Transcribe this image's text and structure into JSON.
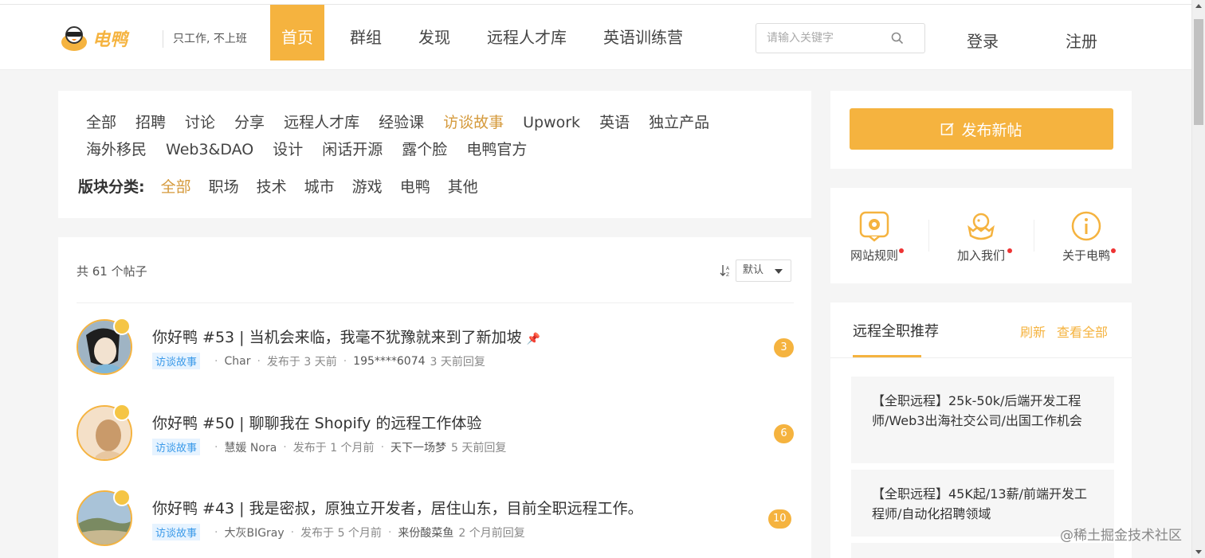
{
  "header": {
    "logo_text": "电鸭",
    "slogan": "只工作, 不上班",
    "nav": [
      "首页",
      "群组",
      "发现",
      "远程人才库",
      "英语训练营"
    ],
    "active_nav": "首页",
    "search_placeholder": "请输入关键字",
    "login": "登录",
    "register": "注册"
  },
  "categories": {
    "tags_row1": [
      "全部",
      "招聘",
      "讨论",
      "分享",
      "远程人才库",
      "经验课",
      "访谈故事",
      "Upwork",
      "英语",
      "独立产品",
      "海外移民"
    ],
    "tags_row2": [
      "Web3&DAO",
      "设计",
      "闲话开源",
      "露个脸",
      "电鸭官方"
    ],
    "selected_tag": "访谈故事",
    "section_label": "版块分类:",
    "sections": [
      "全部",
      "职场",
      "技术",
      "城市",
      "游戏",
      "电鸭",
      "其他"
    ],
    "selected_section": "全部"
  },
  "list": {
    "total": "共 61 个帖子",
    "sort_value": "默认",
    "posts": [
      {
        "title": "你好鸭 #53 | 当机会来临，我毫不犹豫就来到了新加坡",
        "tag": "访谈故事",
        "author": "Char",
        "published": "发布于 3 天前",
        "replier": "195****6074",
        "replied": "3 天前回复",
        "comments": "3"
      },
      {
        "title": "你好鸭 #50 | 聊聊我在 Shopify 的远程工作体验",
        "tag": "访谈故事",
        "author": "慧媛 Nora",
        "published": "发布于 1 个月前",
        "replier": "天下一场梦",
        "replied": "5 天前回复",
        "comments": "6"
      },
      {
        "title": "你好鸭 #43 | 我是密叔，原独立开发者，居住山东，目前全职远程工作。",
        "tag": "访谈故事",
        "author": "大灰BIGray",
        "published": "发布于 5 个月前",
        "replier": "来份酸菜鱼",
        "replied": "2 个月前回复",
        "comments": "10"
      }
    ]
  },
  "sidebar": {
    "publish_label": "发布新帖",
    "links": [
      "网站规则",
      "加入我们",
      "关于电鸭"
    ],
    "rec_title": "远程全职推荐",
    "refresh": "刷新",
    "view_all": "查看全部",
    "jobs": [
      "【全职远程】25k-50k/后端开发工程师/Web3出海社交公司/出国工作机会",
      "【全职远程】45K起/13薪/前端开发工程师/自动化招聘领域"
    ]
  },
  "watermark": "@稀土掘金技术社区",
  "colors": {
    "accent": "#f5b33f",
    "selected_text": "#d59a3c",
    "tag_blue": "#3d9be9"
  }
}
